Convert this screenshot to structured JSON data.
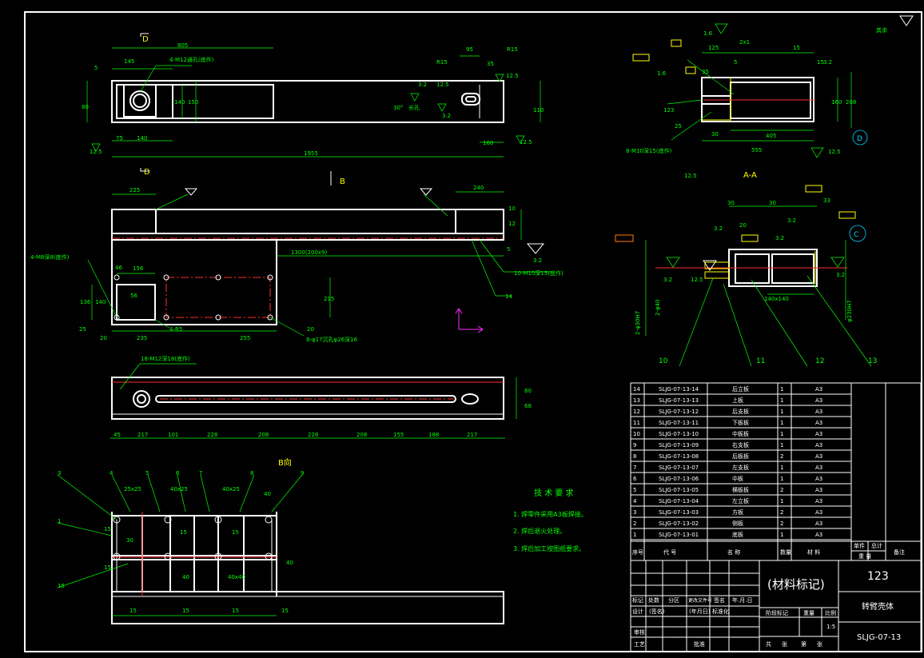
{
  "labels": {
    "view_D_top": "D",
    "view_D_bottom": "D",
    "view_B_mark": "B",
    "section_AA": "A-A",
    "view_B_dir": "B向",
    "circle_C": "C",
    "circle_D": "D",
    "corner_note": "其余"
  },
  "dims_top": [
    "805",
    "145",
    "5",
    "4-M12通孔(底作)",
    "140",
    "150",
    "80",
    "75",
    "140",
    "1955",
    "12.5",
    "R15",
    "95",
    "35",
    "R15",
    "3.2",
    "12.5",
    "30°",
    "长孔",
    "3.2",
    "12.5",
    "160",
    "110",
    "12.5"
  ],
  "dims_mid": [
    "225",
    "240",
    "10",
    "12",
    "5",
    "3.2",
    "4-M8深8(底作)",
    "1300(200x9)",
    "46",
    "156",
    "136",
    "140",
    "56",
    "25",
    "20",
    "235",
    "4-R5",
    "255",
    "215",
    "20",
    "8-φ17沉孔φ26深16",
    "10-M10深15(底作)",
    "14"
  ],
  "dims_strip": [
    "18-M12深18(底作)",
    "45",
    "217",
    "101",
    "228",
    "208",
    "228",
    "208",
    "155",
    "188",
    "217",
    "80",
    "68"
  ],
  "dims_bview": [
    "25x25",
    "40x25",
    "40x25",
    "40",
    "15",
    "30",
    "15",
    "15",
    "15",
    "40",
    "40",
    "40x40",
    "15",
    "15",
    "15",
    "15",
    "1",
    "2",
    "3",
    "4",
    "5",
    "6",
    "7",
    "8",
    "9"
  ],
  "dims_aa": [
    "1.6",
    "125",
    "2x1",
    "15",
    "5",
    "3.2",
    "15",
    "1.6",
    "35",
    "160",
    "208",
    "123",
    "25",
    "30",
    "405",
    "555",
    "8-M10深15(底作)",
    "12.5",
    "12.5"
  ],
  "dims_c": [
    "30",
    "30",
    "20",
    "33",
    "3.2",
    "3.2",
    "3.2",
    "3.2",
    "3.2",
    "12.5",
    "2-φ30H7",
    "2-φ40",
    "140x140",
    "φ230H7",
    "10",
    "11",
    "12",
    "13"
  ],
  "tech_req": {
    "title": "技 术 要 求",
    "items": [
      "1. 焊零件采用A3板焊接。",
      "2. 焊后退火处理。",
      "3. 焊后加工按图纸要求。"
    ]
  },
  "bom": {
    "rows": [
      {
        "no": "14",
        "code": "SLJG-07-13-14",
        "name": "后立板",
        "qty": "1",
        "mat": "A3"
      },
      {
        "no": "13",
        "code": "SLJG-07-13-13",
        "name": "上板",
        "qty": "1",
        "mat": "A3"
      },
      {
        "no": "12",
        "code": "SLJG-07-13-12",
        "name": "后支板",
        "qty": "1",
        "mat": "A3"
      },
      {
        "no": "11",
        "code": "SLJG-07-13-11",
        "name": "下板板",
        "qty": "1",
        "mat": "A3"
      },
      {
        "no": "10",
        "code": "SLJG-07-13-10",
        "name": "中板板",
        "qty": "1",
        "mat": "A3"
      },
      {
        "no": "9",
        "code": "SLJG-07-13-09",
        "name": "右支板",
        "qty": "1",
        "mat": "A3"
      },
      {
        "no": "8",
        "code": "SLJG-07-13-08",
        "name": "后板板",
        "qty": "2",
        "mat": "A3"
      },
      {
        "no": "7",
        "code": "SLJG-07-13-07",
        "name": "左支板",
        "qty": "1",
        "mat": "A3"
      },
      {
        "no": "6",
        "code": "SLJG-07-13-06",
        "name": "中板",
        "qty": "1",
        "mat": "A3"
      },
      {
        "no": "5",
        "code": "SLJG-07-13-05",
        "name": "横板板",
        "qty": "2",
        "mat": "A3"
      },
      {
        "no": "4",
        "code": "SLJG-07-13-04",
        "name": "左立板",
        "qty": "1",
        "mat": "A3"
      },
      {
        "no": "3",
        "code": "SLJG-07-13-03",
        "name": "方板",
        "qty": "2",
        "mat": "A3"
      },
      {
        "no": "2",
        "code": "SLJG-07-13-02",
        "name": "侧板",
        "qty": "2",
        "mat": "A3"
      },
      {
        "no": "1",
        "code": "SLJG-07-13-01",
        "name": "底板",
        "qty": "1",
        "mat": "A3"
      }
    ],
    "header": {
      "no": "序号",
      "code": "代 号",
      "name": "名 称",
      "qty": "数量",
      "mat": "材 料",
      "w1": "单件",
      "w2": "总计",
      "w3": "重 量",
      "remark": "备注"
    }
  },
  "title_block": {
    "material": "(材料标记)",
    "company": "123",
    "part_name": "转臂壳体",
    "drawing_no": "SLJG-07-13",
    "scale": "1:5",
    "row_labels": [
      "标记",
      "处数",
      "分区",
      "更改文件号",
      "签名",
      "年.月.日"
    ],
    "row2": [
      "设计",
      "(签名)",
      "(年月日)",
      "标准化"
    ],
    "row3": [
      "审核"
    ],
    "row4": [
      "工艺",
      "批准"
    ],
    "stage": [
      "阶段标记",
      "重量",
      "比例"
    ],
    "sheet": [
      "共",
      "张",
      "第",
      "张"
    ]
  }
}
